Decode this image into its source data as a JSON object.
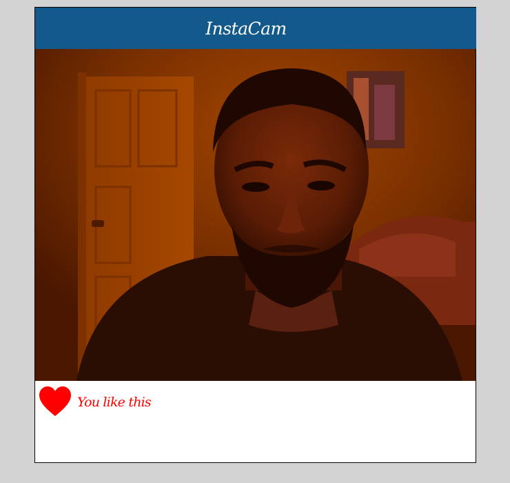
{
  "app": {
    "title": "InstaCam",
    "header_color": "#13598c"
  },
  "camera": {
    "icon": "camera-feed-image"
  },
  "like": {
    "icon": "heart-icon",
    "text": "You like this",
    "color": "#ff0000"
  }
}
